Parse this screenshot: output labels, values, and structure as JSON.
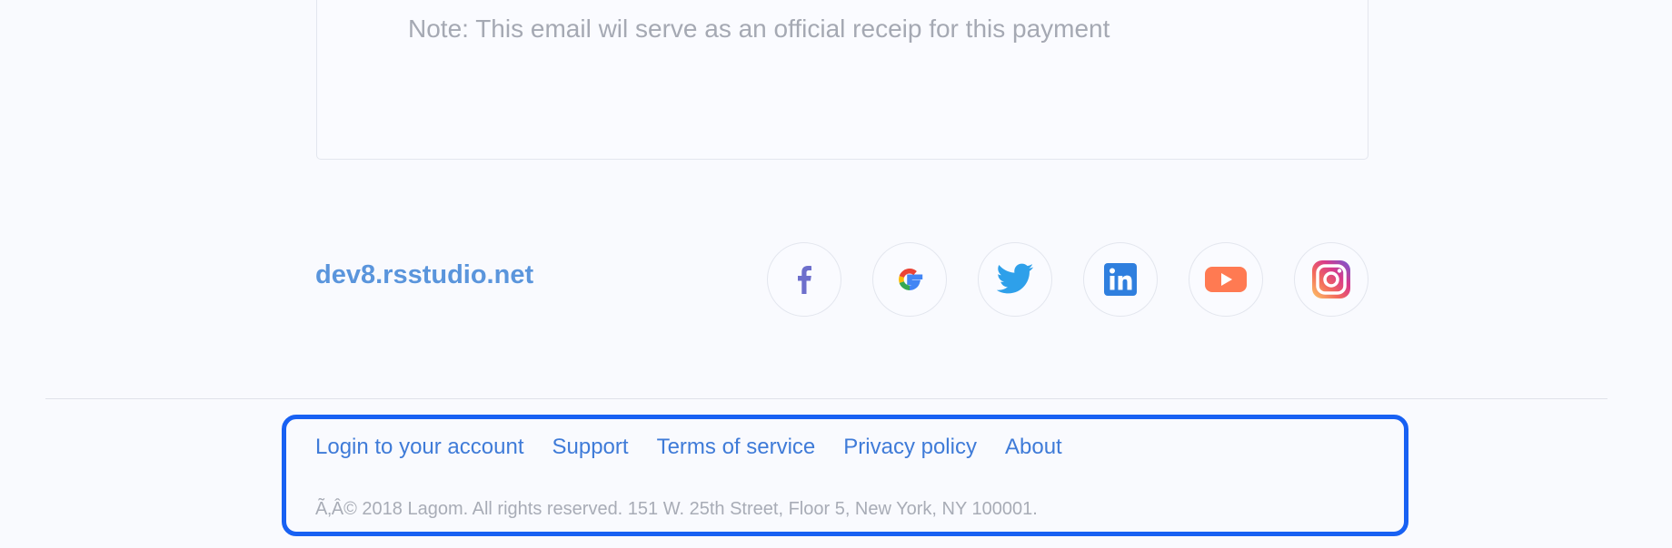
{
  "note": {
    "text": "Note: This email wil serve as an official receip for this payment"
  },
  "brand": {
    "site": "dev8.rsstudio.net",
    "link_color": "#5a95dc"
  },
  "social": [
    {
      "name": "facebook",
      "icon": "facebook-icon",
      "color": "#6d6fcc"
    },
    {
      "name": "google",
      "icon": "google-icon",
      "color": "#ea4335"
    },
    {
      "name": "twitter",
      "icon": "twitter-icon",
      "color": "#2ea0ea"
    },
    {
      "name": "linkedin",
      "icon": "linkedin-icon",
      "color": "#2f7fde"
    },
    {
      "name": "youtube",
      "icon": "youtube-icon",
      "color": "#ff7a52"
    },
    {
      "name": "instagram",
      "icon": "instagram-icon",
      "color": "#e1306c"
    }
  ],
  "footer": {
    "links": [
      "Login to your account",
      "Support",
      "Terms of service",
      "Privacy policy",
      "About"
    ],
    "copyright": "Ã‚Â© 2018 Lagom. All rights reserved. 151 W. 25th Street, Floor 5, New York, NY 100001.",
    "link_color": "#3f7bd8",
    "highlight_color": "#1861f3"
  }
}
